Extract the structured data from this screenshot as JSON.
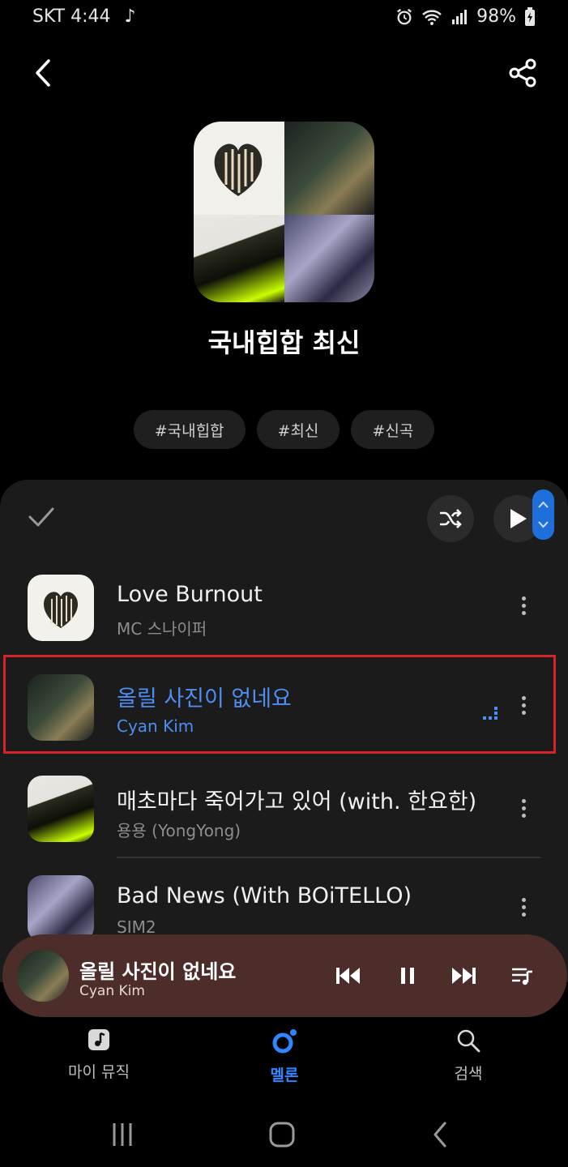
{
  "status_bar": {
    "carrier_time": "SKT 4:44",
    "battery": "98%",
    "icons": [
      "music-note-icon",
      "alarm-icon",
      "wifi-icon",
      "signal-icon",
      "battery-icon"
    ]
  },
  "header": {
    "back_icon": "back-arrow-icon",
    "share_icon": "share-icon"
  },
  "playlist": {
    "title": "국내힙합 최신",
    "tags": [
      "#국내힙합",
      "#최신",
      "#신곡"
    ]
  },
  "list_toolbar": {
    "select_icon": "check-icon",
    "shuffle_icon": "shuffle-icon",
    "play_icon": "play-icon"
  },
  "songs": [
    {
      "title": "Love Burnout",
      "artist": "MC 스나이퍼",
      "playing": false
    },
    {
      "title": "올릴 사진이 없네요",
      "artist": "Cyan Kim",
      "playing": true
    },
    {
      "title": "매초마다 죽어가고 있어 (with. 한요한)",
      "artist": "용용 (YongYong)",
      "playing": false
    },
    {
      "title": "Bad News (With BOiTELLO)",
      "artist": "SIM2",
      "playing": false
    }
  ],
  "mini_player": {
    "title": "올릴 사진이 없네요",
    "artist": "Cyan Kim",
    "controls": [
      "previous-icon",
      "pause-icon",
      "next-icon",
      "queue-icon"
    ],
    "background": "#4d2d29"
  },
  "bottom_nav": {
    "items": [
      {
        "label": "마이 뮤직",
        "icon": "music-note-icon",
        "active": false
      },
      {
        "label": "멜론",
        "icon": "melon-icon",
        "active": true
      },
      {
        "label": "검색",
        "icon": "search-icon",
        "active": false
      }
    ]
  },
  "colors": {
    "accent": "#2f86ff",
    "playing_text": "#4d8ef2",
    "highlight_box": "#d6232a"
  }
}
